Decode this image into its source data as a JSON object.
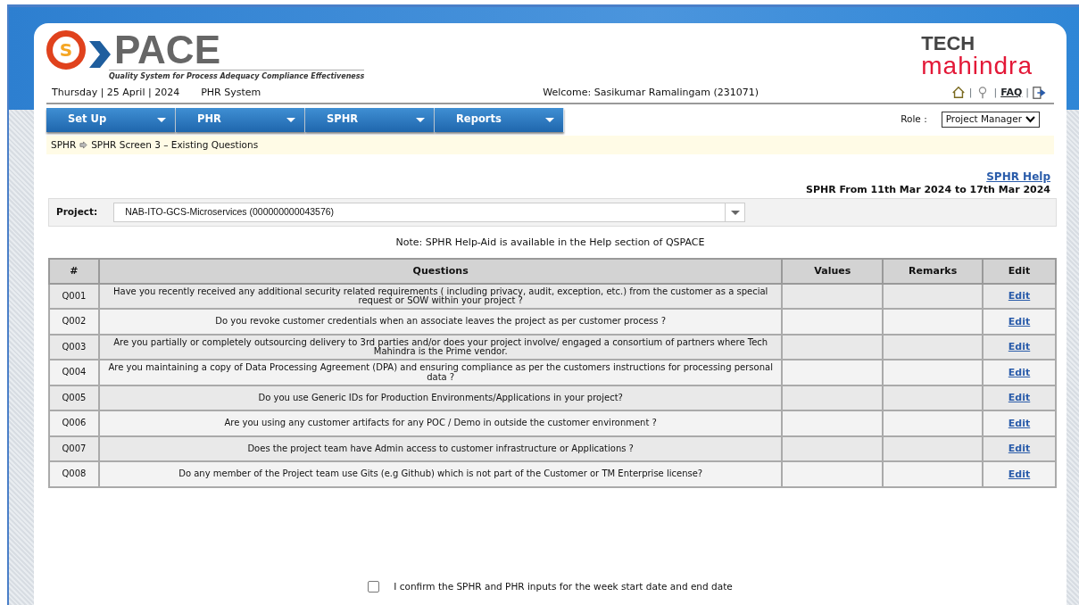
{
  "header": {
    "logo_letter": "S",
    "logo_word": "PACE",
    "tagline": "Quality System for Process Adequacy Compliance Effectiveness",
    "brand_top": "TECH",
    "brand_bottom": "mahindra",
    "date": "Thursday | 25 April | 2024",
    "system": "PHR System",
    "welcome": "Welcome: Sasikumar Ramalingam (231071)",
    "links": [
      {
        "kind": "home"
      },
      {
        "kind": "sep",
        "text": "|"
      },
      {
        "kind": "help"
      },
      {
        "kind": "sep",
        "text": "|"
      },
      {
        "kind": "text",
        "text": "FAQ"
      },
      {
        "kind": "sep",
        "text": "|"
      },
      {
        "kind": "logout"
      }
    ]
  },
  "menu": [
    {
      "label": "Set Up"
    },
    {
      "label": "PHR"
    },
    {
      "label": "SPHR"
    },
    {
      "label": "Reports"
    }
  ],
  "role": {
    "label": "Role :",
    "value": "Project Manager"
  },
  "breadcrumb": [
    "SPHR",
    "SPHR Screen 3 – Existing Questions"
  ],
  "help_link": "SPHR Help",
  "period": "SPHR From 11th Mar 2024 to 17th Mar 2024",
  "project": {
    "label": "Project:",
    "value": "NAB-ITO-GCS-Microservices (000000000043576)"
  },
  "note": "Note: SPHR Help-Aid is available in the Help section of QSPACE",
  "table": {
    "columns": [
      "#",
      "Questions",
      "Values",
      "Remarks",
      "Edit"
    ],
    "rows": [
      {
        "id": "Q001",
        "question": "Have you recently received any additional security related requirements ( including privacy, audit, exception, etc.) from the customer as a special request or SOW within your project ?",
        "action": "Edit"
      },
      {
        "id": "Q002",
        "question": "Do you revoke customer credentials when an associate leaves the project as per customer process ?",
        "action": "Edit"
      },
      {
        "id": "Q003",
        "question": "Are you partially or completely outsourcing delivery to 3rd parties and/or does your project involve/ engaged a consortium of partners where Tech Mahindra is the Prime vendor.",
        "action": "Edit"
      },
      {
        "id": "Q004",
        "question": "Are you maintaining a copy of Data Processing Agreement (DPA) and ensuring compliance as per the customers instructions for processing personal data ?",
        "action": "Edit"
      },
      {
        "id": "Q005",
        "question": "Do you use Generic IDs for Production Environments/Applications in your project?",
        "action": "Edit"
      },
      {
        "id": "Q006",
        "question": "Are you using any customer artifacts for any POC / Demo in outside the customer environment ?",
        "action": "Edit"
      },
      {
        "id": "Q007",
        "question": "Does the project team have Admin access to customer infrastructure or Applications ?",
        "action": "Edit"
      },
      {
        "id": "Q008",
        "question": "Do any member of the Project team use Gits (e.g Github) which is not part of the Customer or TM Enterprise license?",
        "action": "Edit"
      }
    ]
  },
  "confirm": {
    "label": "I confirm the SPHR and PHR inputs for the week start date and end date",
    "checked": false
  }
}
